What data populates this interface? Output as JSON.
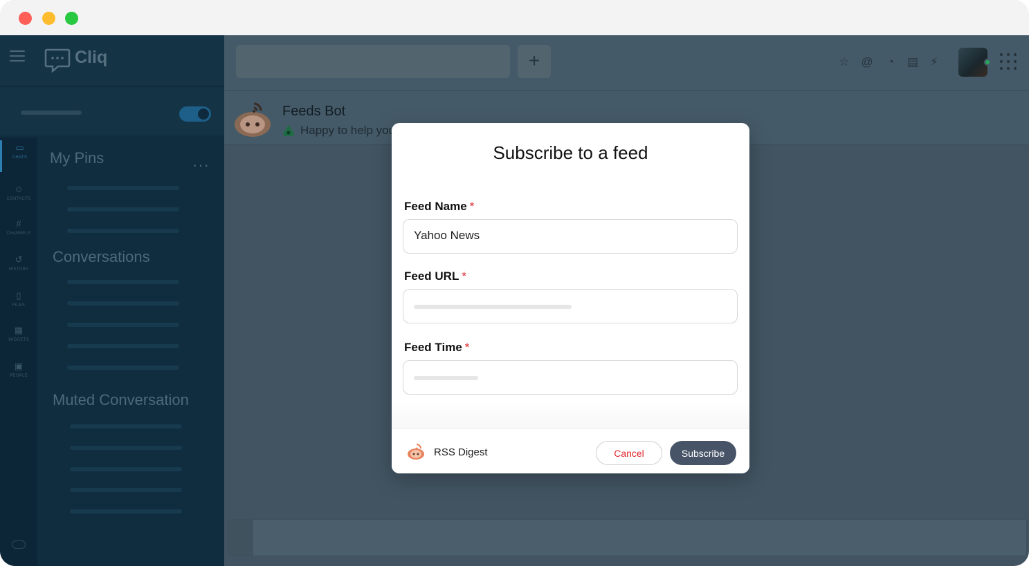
{
  "app": {
    "name": "Cliq",
    "accent_color": "#475468",
    "required_color": "#e0262d"
  },
  "sidebar": {
    "sections": {
      "pins": "My Pins",
      "conversations": "Conversations",
      "muted": "Muted Conversation"
    },
    "rail": [
      {
        "label": "CHATS",
        "icon": "chat-icon"
      },
      {
        "label": "CONTACTS",
        "icon": "contacts-icon"
      },
      {
        "label": "CHANNELS",
        "icon": "hash-icon"
      },
      {
        "label": "HISTORY",
        "icon": "history-icon"
      },
      {
        "label": "FILES",
        "icon": "file-icon"
      },
      {
        "label": "WIDGETS",
        "icon": "widgets-icon"
      },
      {
        "label": "PEOPLE",
        "icon": "people-icon"
      }
    ]
  },
  "topbar": {
    "icons": [
      "star-icon",
      "mention-icon",
      "reminder-icon",
      "calendar-icon",
      "plug-icon",
      "apps-grid-icon"
    ]
  },
  "chat": {
    "bot_name": "Feeds Bot",
    "bot_status": "Happy to help you"
  },
  "modal": {
    "title": "Subscribe to a feed",
    "fields": [
      {
        "label": "Feed Name",
        "required_mark": "*",
        "value": "Yahoo News"
      },
      {
        "label": "Feed URL",
        "required_mark": "*",
        "value": ""
      },
      {
        "label": "Feed Time",
        "required_mark": "*",
        "value": ""
      }
    ],
    "footer": {
      "bot_name": "RSS Digest",
      "cancel_label": "Cancel",
      "subscribe_label": "Subscribe"
    }
  }
}
